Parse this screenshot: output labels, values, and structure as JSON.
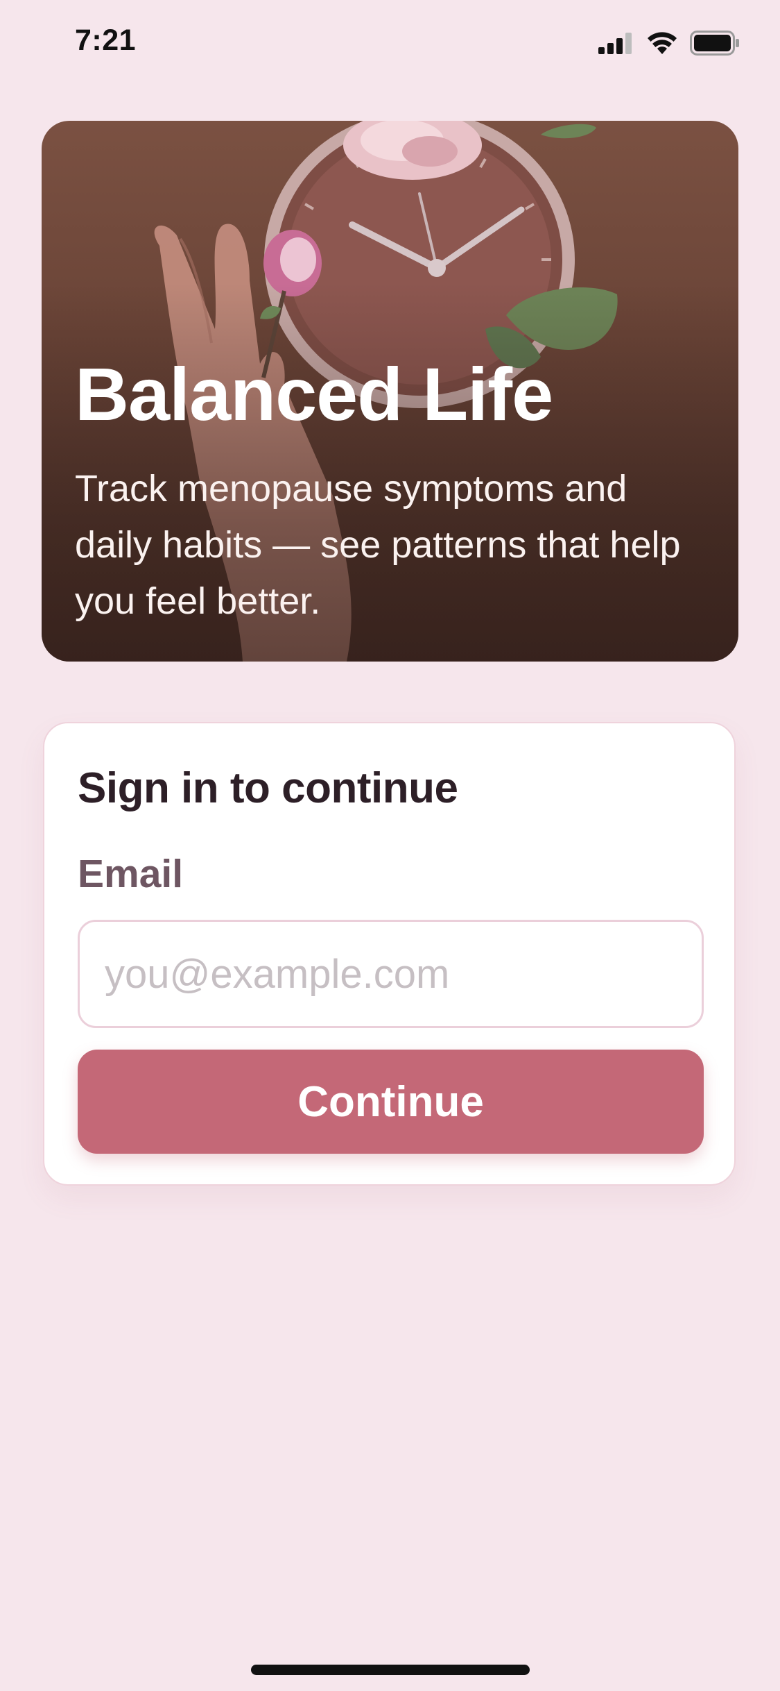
{
  "status_bar": {
    "time": "7:21",
    "icons": [
      "cellular-signal-icon",
      "wifi-icon",
      "battery-icon"
    ]
  },
  "hero": {
    "title": "Balanced Life",
    "subtitle": "Track menopause symptoms and daily habits — see patterns that help you feel better.",
    "image_description_icon": "clock-hand-roses-image"
  },
  "signin": {
    "heading": "Sign in to continue",
    "email_label": "Email",
    "email_placeholder": "you@example.com",
    "email_value": "",
    "continue_label": "Continue"
  },
  "colors": {
    "background": "#f6e6ec",
    "accent": "#c46877",
    "card": "#ffffff",
    "heading_text": "#2d1f27",
    "label_text": "#6e5662"
  }
}
